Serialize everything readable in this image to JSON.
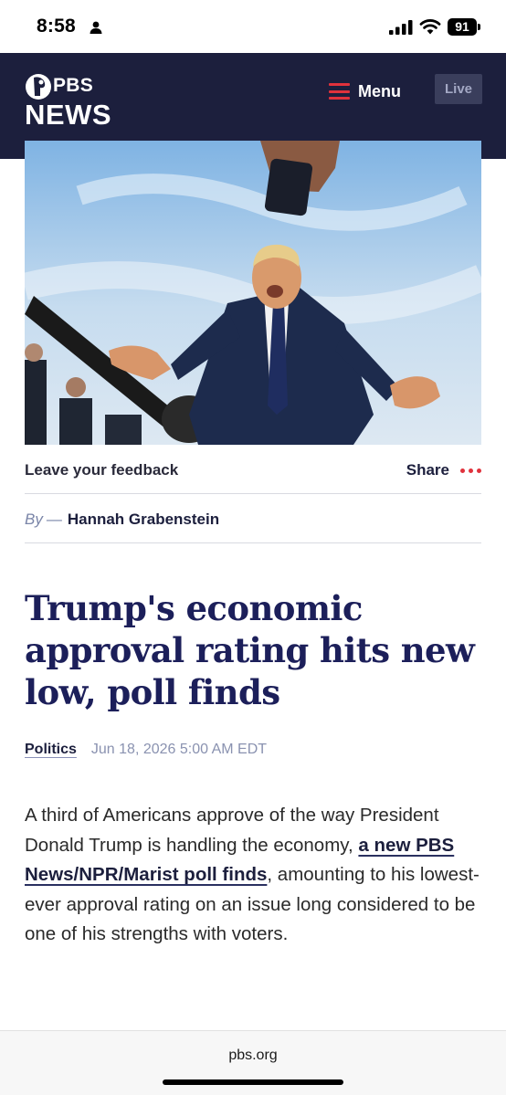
{
  "status_bar": {
    "time": "8:58",
    "battery": "91"
  },
  "header": {
    "logo_pbs": "PBS",
    "logo_news": "NEWS",
    "menu_label": "Menu",
    "live_label": "Live",
    "background_color": "#1c1f3d",
    "accent_color": "#e0323c"
  },
  "article_tools": {
    "feedback_label": "Leave your feedback",
    "share_label": "Share"
  },
  "byline": {
    "prefix": "By",
    "dash": "—",
    "author": "Hannah Grabenstein"
  },
  "article": {
    "headline": "Trump's economic approval rating hits new low, poll finds",
    "category": "Politics",
    "date": "Jun 18, 2026 5:00 AM EDT",
    "body_before_link": "A third of Americans approve of the way President Donald Trump is handling the economy, ",
    "body_link": "a new PBS News/NPR/Marist poll finds",
    "body_after_link": ", amounting to his lowest-ever approval rating on an issue long considered to be one of his strengths with voters."
  },
  "browser": {
    "url": "pbs.org"
  }
}
